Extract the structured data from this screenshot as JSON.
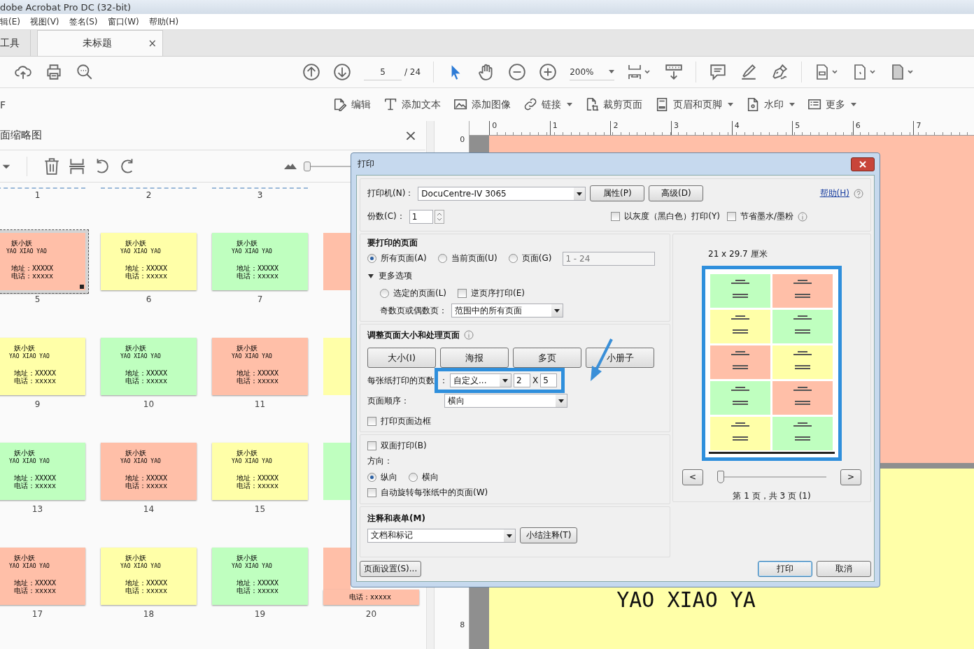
{
  "window": {
    "title": "dobe Acrobat Pro DC (32-bit)"
  },
  "menu": [
    "辑(E)",
    "视图(V)",
    "签名(S)",
    "窗口(W)",
    "帮助(H)"
  ],
  "tabs": [
    {
      "label": "工具",
      "selected": false
    },
    {
      "label": "未标题",
      "selected": true,
      "close": "×"
    }
  ],
  "toolbar": {
    "page": "5",
    "page_total": "/ 24",
    "zoom": "200%"
  },
  "edit_toolbar": {
    "left_label": "F",
    "tools": [
      {
        "label": "编辑",
        "dropdown": false
      },
      {
        "label": "添加文本",
        "dropdown": false
      },
      {
        "label": "添加图像",
        "dropdown": false
      },
      {
        "label": "链接",
        "dropdown": true
      },
      {
        "label": "裁剪页面",
        "dropdown": false
      },
      {
        "label": "页眉和页脚",
        "dropdown": true
      },
      {
        "label": "水印",
        "dropdown": true
      },
      {
        "label": "更多",
        "dropdown": true
      }
    ]
  },
  "thumbnails": {
    "title": "面缩略图",
    "close": "×",
    "level": 0,
    "top_labels": [
      "1",
      "2",
      "3"
    ],
    "pages": [
      {
        "number": "5",
        "color": "#ffbfa8",
        "selected": true,
        "name": "妖小妖",
        "pinyin": "YAO XIAO YAO",
        "address": "地址：XXXXX",
        "phone": "电话：xxxxx"
      },
      {
        "number": "6",
        "color": "#ffffa8",
        "selected": false,
        "name": "妖小妖",
        "pinyin": "YAO XIAO YAO",
        "address": "地址：XXXXX",
        "phone": "电话：xxxxx"
      },
      {
        "number": "7",
        "color": "#bfffbf",
        "selected": false,
        "name": "妖小妖",
        "pinyin": "YAO XIAO YAO",
        "address": "地址：XXXXX",
        "phone": "电话：xxxxx"
      },
      {
        "color": "#ffbfa8",
        "selected": false
      },
      {
        "number": "9",
        "color": "#ffffa8",
        "selected": false,
        "name": "妖小妖",
        "pinyin": "YAO XIAO YAO",
        "address": "地址：XXXXX",
        "phone": "电话：xxxxx"
      },
      {
        "number": "10",
        "color": "#bfffbf",
        "selected": false,
        "name": "妖小妖",
        "pinyin": "YAO XIAO YAO",
        "address": "地址：XXXXX",
        "phone": "电话：xxxxx"
      },
      {
        "number": "11",
        "color": "#ffbfa8",
        "selected": false,
        "name": "妖小妖",
        "pinyin": "YAO XIAO YAO",
        "address": "地址：XXXXX",
        "phone": "电话：xxxxx"
      },
      {
        "color": "#ffffa8",
        "selected": false
      },
      {
        "number": "13",
        "color": "#bfffbf",
        "selected": false,
        "name": "妖小妖",
        "pinyin": "YAO XIAO YAO",
        "address": "地址：XXXXX",
        "phone": "电话：xxxxx"
      },
      {
        "number": "14",
        "color": "#ffbfa8",
        "selected": false,
        "name": "妖小妖",
        "pinyin": "YAO XIAO YAO",
        "address": "地址：XXXXX",
        "phone": "电话：xxxxx"
      },
      {
        "number": "15",
        "color": "#ffffa8",
        "selected": false,
        "name": "妖小妖",
        "pinyin": "YAO XIAO YAO",
        "address": "地址：XXXXX",
        "phone": "电话：xxxxx"
      },
      {
        "color": "#bfffbf",
        "selected": false
      },
      {
        "number": "17",
        "color": "#ffbfa8",
        "selected": false,
        "name": "妖小妖",
        "pinyin": "YAO XIAO YAO",
        "address": "地址：XXXXX",
        "phone": "电话：xxxxx"
      },
      {
        "number": "18",
        "color": "#ffffa8",
        "selected": false,
        "name": "妖小妖",
        "pinyin": "YAO XIAO YAO",
        "address": "地址：XXXXX",
        "phone": "电话：xxxxx"
      },
      {
        "number": "19",
        "color": "#bfffbf",
        "selected": false,
        "name": "妖小妖",
        "pinyin": "YAO XIAO YAO",
        "address": "地址：XXXXX",
        "phone": "电话：xxxxx"
      },
      {
        "number": "20",
        "color": "#ffbfa8",
        "selected": false,
        "phone": "电话：xxxxx"
      }
    ]
  },
  "ruler": {
    "x_labels": [
      "0",
      "1",
      "2",
      "3",
      "4",
      "5",
      "6",
      "7"
    ],
    "y_labels": [
      "0",
      "8"
    ]
  },
  "document": {
    "text": "YAO XIAO YA"
  },
  "print_dialog": {
    "title": "打印",
    "printer_label": "打印机(N)：",
    "printer": "DocuCentre-IV 3065",
    "top_buttons": [
      "属性(P)",
      "高级(D)"
    ],
    "help": "帮助(H)",
    "copies_label": "份数(C)：",
    "copies": "1",
    "grayscale": {
      "label": "以灰度（黑白色）打印(Y)",
      "checked": false
    },
    "save_ink": {
      "label": "节省墨水/墨粉",
      "checked": false
    },
    "pages_section": {
      "title": "要打印的页面",
      "options": [
        {
          "label": "所有页面(A)",
          "selected": true
        },
        {
          "label": "当前页面(U)",
          "selected": false
        },
        {
          "label": "页面(G)",
          "selected": false
        }
      ],
      "range": "1 - 24",
      "more": {
        "label": "更多选项",
        "expanded": true
      },
      "selected_pages": {
        "label": "选定的页面(L)",
        "selected": false
      },
      "reverse": {
        "label": "逆页序打印(E)",
        "checked": false
      },
      "odd_even_label": "奇数页或偶数页：",
      "odd_even": "范围中的所有页面"
    },
    "sizing": {
      "title": "调整页面大小和处理页面",
      "modes": [
        "大小(I)",
        "海报",
        "多页",
        "小册子"
      ],
      "per_sheet_label": "每张纸打印的页数",
      "per_sheet_colon": "：",
      "per_sheet": "自定义...",
      "columns": "2",
      "times": "X",
      "rows": "5",
      "order_label": "页面顺序：",
      "order": "横向",
      "border": {
        "label": "打印页面边框",
        "checked": false
      }
    },
    "duplex": {
      "label": "双面打印(B)",
      "checked": false
    },
    "orientation_label": "方向：",
    "orientation": [
      {
        "label": "纵向",
        "selected": true
      },
      {
        "label": "横向",
        "selected": false
      }
    ],
    "auto_rotate": {
      "label": "自动旋转每张纸中的页面(W)",
      "checked": false
    },
    "comments": {
      "title": "注释和表单(M)",
      "value": "文档和标记",
      "summarize": "小结注释(T)"
    },
    "preview": {
      "size": "21 x 29.7 厘米",
      "cells": [
        {
          "color": "#bfffbf"
        },
        {
          "color": "#ffbfa8"
        },
        {
          "color": "#ffffa8"
        },
        {
          "color": "#bfffbf"
        },
        {
          "color": "#ffbfa8"
        },
        {
          "color": "#ffffa8"
        },
        {
          "color": "#bfffbf"
        },
        {
          "color": "#ffbfa8"
        },
        {
          "color": "#ffffa8"
        },
        {
          "color": "#bfffbf"
        }
      ],
      "prev": "<",
      "next": ">",
      "level": 0,
      "status": "第 1 页，共 3 页 (1)"
    },
    "page_setup": "页面设置(S)...",
    "print": "打印",
    "cancel": "取消"
  }
}
